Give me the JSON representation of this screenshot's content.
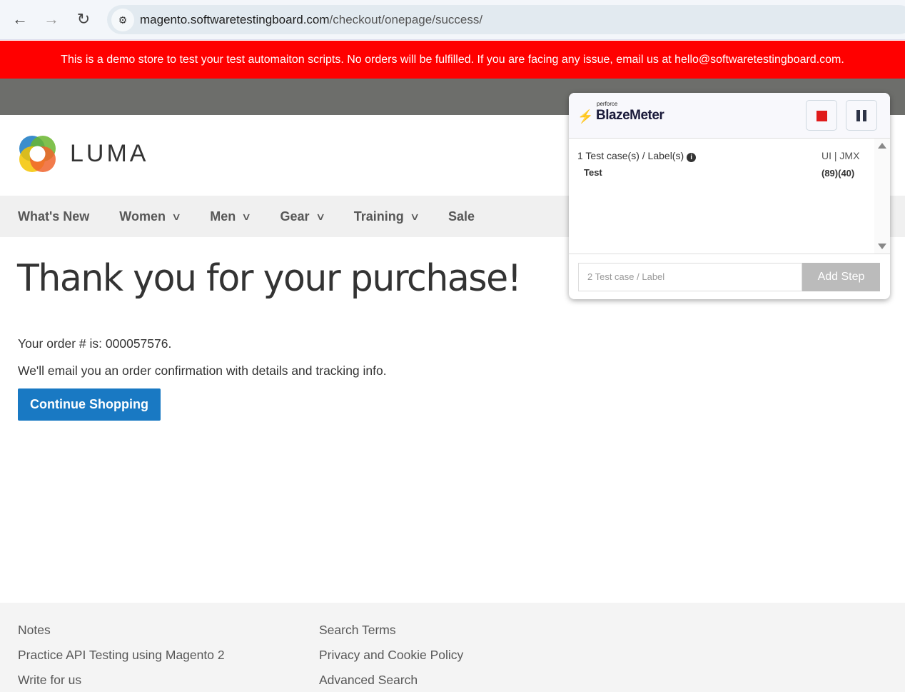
{
  "browser": {
    "back": "←",
    "forward": "→",
    "reload": "↻",
    "url_host": "magento.softwaretestingboard.com",
    "url_path": "/checkout/onepage/success/"
  },
  "banner": "This is a demo store to test your test automaiton scripts. No orders will be fulfilled. If you are facing any issue, email us at hello@softwaretestingboard.com.",
  "logo": "LUMA",
  "nav": [
    {
      "label": "What's New"
    },
    {
      "label": "Women"
    },
    {
      "label": "Men"
    },
    {
      "label": "Gear"
    },
    {
      "label": "Training"
    },
    {
      "label": "Sale"
    }
  ],
  "main": {
    "title": "Thank you for your purchase!",
    "order": "Your order # is: 000057576.",
    "email_note": "We'll email you an order confirmation with details and tracking info.",
    "continue": "Continue Shopping"
  },
  "footer": {
    "col1": [
      "Notes",
      "Practice API Testing using Magento 2",
      "Write for us"
    ],
    "col2": [
      "Search Terms",
      "Privacy and Cookie Policy",
      "Advanced Search"
    ]
  },
  "blazemeter": {
    "brand_small": "perforce",
    "brand": "BlazeMeter",
    "count_label": "1 Test case(s) / Label(s)",
    "mode": "UI | JMX",
    "test_name": "Test",
    "test_counts": "(89)(40)",
    "input_placeholder": "2 Test case / Label",
    "add_step": "Add Step",
    "accent": "#5b2de0"
  }
}
